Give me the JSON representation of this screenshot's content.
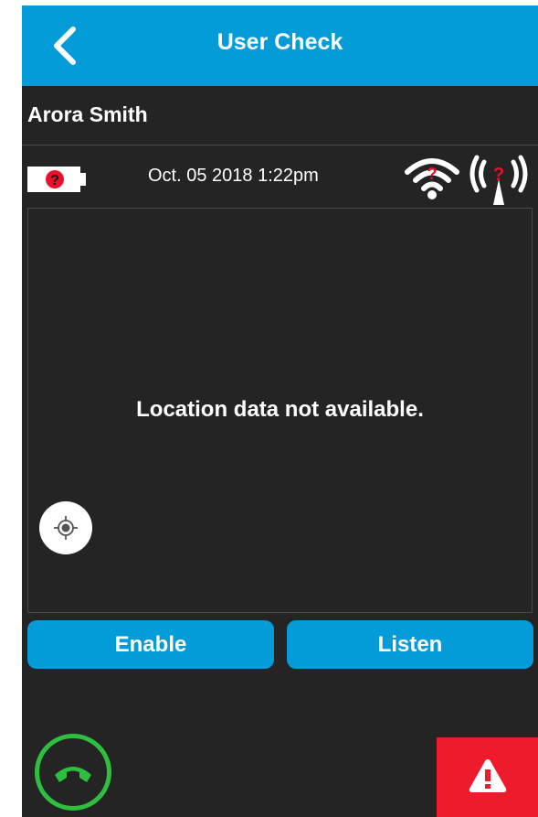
{
  "header": {
    "title": "User Check",
    "back_icon": "chevron-left-icon",
    "background_color": "#039bd8"
  },
  "user": {
    "name": "Arora Smith"
  },
  "status": {
    "battery_icon": "battery-unknown-icon",
    "timestamp": "Oct. 05 2018 1:22pm",
    "wifi_icon": "wifi-unknown-icon",
    "cellular_icon": "cell-tower-unknown-icon"
  },
  "map": {
    "message": "Location data not available.",
    "locate_icon": "locate-icon"
  },
  "actions": {
    "enable_label": "Enable",
    "listen_label": "Listen"
  },
  "footer": {
    "hangup_icon": "hang-up-phone-icon",
    "hangup_color": "#2fbf3f",
    "alert_icon": "warning-icon",
    "alert_color": "#ee1b2d"
  }
}
